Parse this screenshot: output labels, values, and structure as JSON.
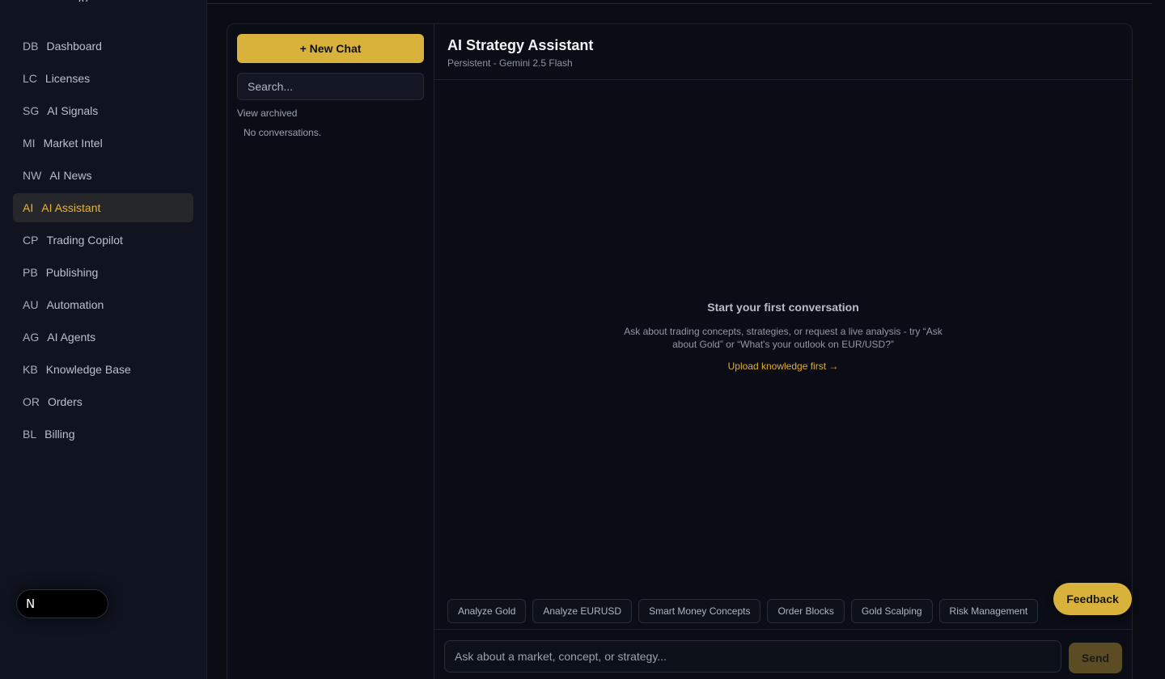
{
  "sidebar": {
    "items": [
      {
        "abbr": "DB",
        "label": "Dashboard"
      },
      {
        "abbr": "LC",
        "label": "Licenses"
      },
      {
        "abbr": "SG",
        "label": "AI Signals"
      },
      {
        "abbr": "MI",
        "label": "Market Intel"
      },
      {
        "abbr": "NW",
        "label": "AI News"
      },
      {
        "abbr": "AI",
        "label": "AI Assistant"
      },
      {
        "abbr": "CP",
        "label": "Trading Copilot"
      },
      {
        "abbr": "PB",
        "label": "Publishing"
      },
      {
        "abbr": "AU",
        "label": "Automation"
      },
      {
        "abbr": "AG",
        "label": "AI Agents"
      },
      {
        "abbr": "KB",
        "label": "Knowledge Base"
      },
      {
        "abbr": "OR",
        "label": "Orders"
      },
      {
        "abbr": "BL",
        "label": "Billing"
      }
    ],
    "active_index": 5,
    "n_badge": "N"
  },
  "conversations": {
    "new_chat_label": "+ New Chat",
    "search_placeholder": "Search...",
    "view_archived": "View archived",
    "empty": "No conversations."
  },
  "chat": {
    "title": "AI Strategy Assistant",
    "subtitle": "Persistent - Gemini 2.5 Flash",
    "empty_title": "Start your first conversation",
    "empty_desc": "Ask about trading concepts, strategies, or request a live analysis - try “Ask about Gold” or “What's your outlook on EUR/USD?”",
    "upload_link": "Upload knowledge first →",
    "chips": [
      "Analyze Gold",
      "Analyze EURUSD",
      "Smart Money Concepts",
      "Order Blocks",
      "Gold Scalping",
      "Risk Management"
    ],
    "input_placeholder": "Ask about a market, concept, or strategy...",
    "send_label": "Send"
  },
  "feedback_label": "Feedback",
  "colors": {
    "accent": "#d9b23c",
    "active_text": "#e6b337",
    "background": "#090c13",
    "sidebar": "#0f1420"
  }
}
